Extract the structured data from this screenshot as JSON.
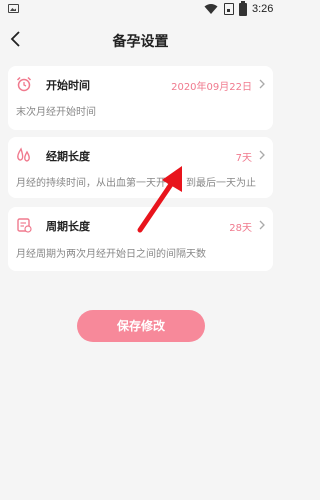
{
  "status_bar": {
    "time": "3:26",
    "icons": [
      "image-icon",
      "wifi-icon",
      "sim-icon",
      "battery-icon"
    ]
  },
  "nav": {
    "title": "备孕设置",
    "back_icon": "back-chevron-icon"
  },
  "settings": [
    {
      "icon": "alarm-clock-icon",
      "label": "开始时间",
      "value": "2020年09月22日",
      "desc": "末次月经开始时间"
    },
    {
      "icon": "drops-icon",
      "label": "经期长度",
      "value": "7天",
      "desc": "月经的持续时间，从出血第一天开始，到最后一天为止"
    },
    {
      "icon": "calendar-icon",
      "label": "周期长度",
      "value": "28天",
      "desc": "月经周期为两次月经开始日之间的间隔天数"
    }
  ],
  "save_button": {
    "label": "保存修改"
  },
  "colors": {
    "accent": "#f07a8e",
    "button": "#f7899a",
    "background": "#f5f5f5",
    "annotation_arrow": "#e8141c"
  }
}
